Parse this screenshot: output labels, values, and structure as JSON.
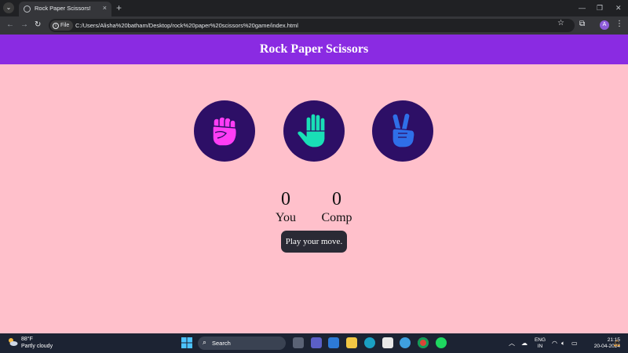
{
  "browser": {
    "tab_title": "Rock Paper Scissors!",
    "new_tab": "+",
    "close_tab": "×",
    "file_chip": "File",
    "url": "C:/Users/Alisha%20batham/Desktop/rock%20paper%20scissors%20game/index.html",
    "avatar_letter": "A",
    "minimize": "—",
    "restore": "❐",
    "close_window": "✕"
  },
  "page": {
    "title": "Rock Paper Scissors",
    "choices": [
      {
        "id": "rock",
        "icon": "fist-icon",
        "color": "#ff3df5"
      },
      {
        "id": "paper",
        "icon": "open-hand-icon",
        "color": "#19dfb6"
      },
      {
        "id": "scissors",
        "icon": "peace-hand-icon",
        "color": "#2f6fe8"
      }
    ],
    "score": {
      "user_score": "0",
      "user_label": "You",
      "comp_score": "0",
      "comp_label": "Comp"
    },
    "message": "Play your move."
  },
  "colors": {
    "header_bg": "#8a2be2",
    "page_bg": "#ffc0cb",
    "choice_bg": "#2d0f66",
    "msg_bg": "#2a2a35"
  },
  "taskbar": {
    "weather_temp": "88°F",
    "weather_desc": "Partly cloudy",
    "search_label": "Search",
    "lang_top": "ENG",
    "lang_bottom": "IN",
    "time": "21:15",
    "date": "20-04-2024"
  }
}
